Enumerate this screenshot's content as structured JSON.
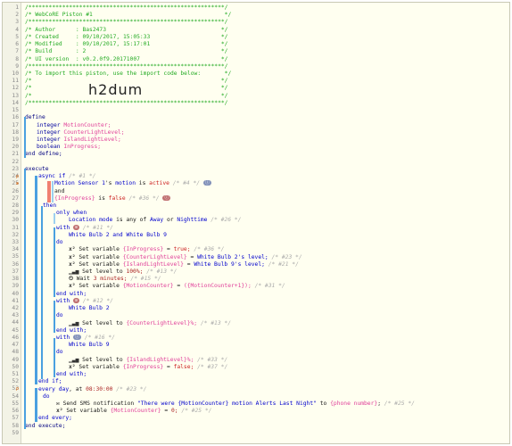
{
  "editor": {
    "line_numbers": [
      "1",
      "2",
      "3",
      "4",
      "5",
      "6",
      "7",
      "8",
      "9",
      "10",
      "11",
      "12",
      "13",
      "14",
      "15",
      "16",
      "17",
      "18",
      "19",
      "20",
      "21",
      "22",
      "23",
      "24",
      "25",
      "26",
      "27",
      "28",
      "29",
      "30",
      "31",
      "32",
      "33",
      "34",
      "35",
      "36",
      "37",
      "38",
      "39",
      "40",
      "41",
      "42",
      "43",
      "44",
      "45",
      "46",
      "47",
      "48",
      "49",
      "50",
      "51",
      "52",
      "53",
      "54",
      "55",
      "56",
      "57",
      "58",
      "59"
    ],
    "header": {
      "border": "/**********************************************************/",
      "title": "/* WebCoRE Piston #1                                       */",
      "author": "/* Author      : Bas2473                                  */",
      "created": "/* Created     : 09/10/2017, 15:05:33                     */",
      "modified": "/* Modified    : 09/10/2017, 15:17:01                     */",
      "build": "/* Build       : 2                                        */",
      "ui_version": "/* UI version  : v0.2.0f9.20171007                        */",
      "import_note": "/* To import this piston, use the import code below:       */",
      "blank": "/*                                                        */",
      "import_code": "h2dum"
    },
    "define": {
      "keyword": "define",
      "vars": [
        {
          "type": "integer",
          "name": "MotionCounter;"
        },
        {
          "type": "integer",
          "name": "CounterLightLevel;"
        },
        {
          "type": "integer",
          "name": "IslandLightLevel;"
        },
        {
          "type": "boolean",
          "name": "InProgress;"
        }
      ],
      "end": "end define;"
    },
    "execute": {
      "keyword": "execute",
      "async_if": "async if",
      "async_if_cmt": "/* #1 */",
      "cond1_dev": "Motion Sensor 1",
      "cond1_s": "'s ",
      "cond1_attr": "motion",
      "cond1_is": " is ",
      "cond1_val": "active",
      "cond1_cmt": "/* #4 */",
      "and": "and",
      "cond2_var": "{InProgress}",
      "cond2_is": " is ",
      "cond2_val": "false",
      "cond2_cmt": "/* #36 */",
      "then": "then",
      "only_when": "only when",
      "ow_text1": "Location mode",
      "ow_text2": " is any of ",
      "ow_val1": "Away",
      "ow_or": " or ",
      "ow_val2": "Nighttime",
      "ow_cmt": "/* #26 */",
      "with": "with",
      "with1_cmt": "/* #11 */",
      "with1_dev": "White Bulb 2 and White Bulb 9",
      "do": "do",
      "set1_a": "Set variable ",
      "set1_var": "{InProgress}",
      "set1_eq": " = ",
      "set1_val": "true;",
      "set1_cmt": "/* #36 */",
      "set2_var": "{CounterLightLevel}",
      "set2_val": "White Bulb 2's level;",
      "set2_cmt": "/* #23 */",
      "set3_var": "{IslandLightLevel}",
      "set3_val": "White Bulb 9's level;",
      "set3_cmt": "/* #21 */",
      "level_a": "Set level to ",
      "level_100": "100%;",
      "level_100_cmt": "/* #13 */",
      "wait_a": "Wait ",
      "wait_val": "3 minutes;",
      "wait_cmt": "/* #15 */",
      "set4_var": "{MotionCounter}",
      "set4_val": "({MotionCounter+1});",
      "set4_cmt": "/* #31 */",
      "end_with": "end with;",
      "with2_cmt": "/* #12 */",
      "with2_dev": "White Bulb 2",
      "level2_val": "{CounterLightLevel}%;",
      "level2_cmt": "/* #13 */",
      "with3_cmt": "/* #16 */",
      "with3_dev": "White Bulb 9",
      "level3_val": "{IslandLightLevel}%;",
      "level3_cmt": "/* #33 */",
      "set5_val": "false;",
      "set5_cmt": "/* #37 */",
      "end_if": "end if;",
      "every_a": "every day",
      "every_b": ", at ",
      "every_time": "08:30:00",
      "every_cmt": "/* #23 */",
      "sms_a": "Send SMS notification ",
      "sms_str": "\"There were {MotionCounter} motion Alerts Last Night\"",
      "sms_to": " to ",
      "sms_phone": "{phone number}",
      "sms_semi": ";",
      "sms_cmt": "/* #25 */",
      "set6_val": "0;",
      "set6_cmt": "/* #25 */",
      "end_every": "end every;",
      "end_execute": "end execute;"
    }
  },
  "colors": {
    "background": "#fffff0",
    "comment": "#22aa22",
    "keyword": "#0000cc",
    "variable": "#e0409a",
    "bar_blue": "#4aa0e0",
    "bar_red": "#f08070"
  }
}
